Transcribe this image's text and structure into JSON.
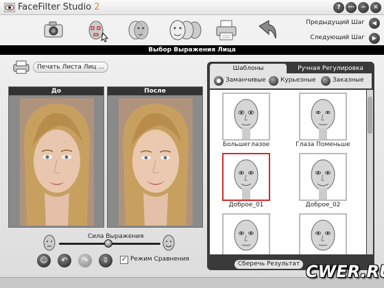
{
  "app": {
    "title": "FaceFilter Studio",
    "version": "2"
  },
  "window_buttons": [
    "?",
    "⋯",
    "−",
    "✕"
  ],
  "toolbar": {
    "tools": [
      "camera-icon",
      "face-points-icon",
      "face-morph-icon",
      "expression-faces-icon",
      "printer-icon",
      "share-icon"
    ],
    "prev_step": "Предыдущий Шаг",
    "next_step": "Следующий Шаг"
  },
  "section_title": "Выбор Выражения Лица",
  "left": {
    "print_label": "Печать Листа Лиц ...",
    "before_label": "До",
    "after_label": "После",
    "strength_label": "Сила Выражения",
    "strength_value": 0.5,
    "compare_label": "Режим Сравнения",
    "compare_checked": true
  },
  "right": {
    "tabs": [
      "Шаблоны",
      "Ручная Регулировка"
    ],
    "filters": [
      {
        "label": "Заманчивые",
        "selected": true
      },
      {
        "label": "Курьезные",
        "selected": false
      },
      {
        "label": "Заказные",
        "selected": false
      }
    ],
    "templates": [
      {
        "caption": "Большеглазое",
        "selected": false
      },
      {
        "caption": "Глаза Поменьше",
        "selected": false
      },
      {
        "caption": "Доброе_01",
        "selected": true
      },
      {
        "caption": "Доброе_02",
        "selected": false
      },
      {
        "caption": "",
        "selected": false
      },
      {
        "caption": "",
        "selected": false
      }
    ],
    "save_label": "Сберечь Результат"
  },
  "watermark": "CWER.RU",
  "colors": {
    "accent_orange": "#e08a2b",
    "section_bar": "#000000",
    "selected_border": "#d62828",
    "panel_dark": "#3a3a3a"
  }
}
